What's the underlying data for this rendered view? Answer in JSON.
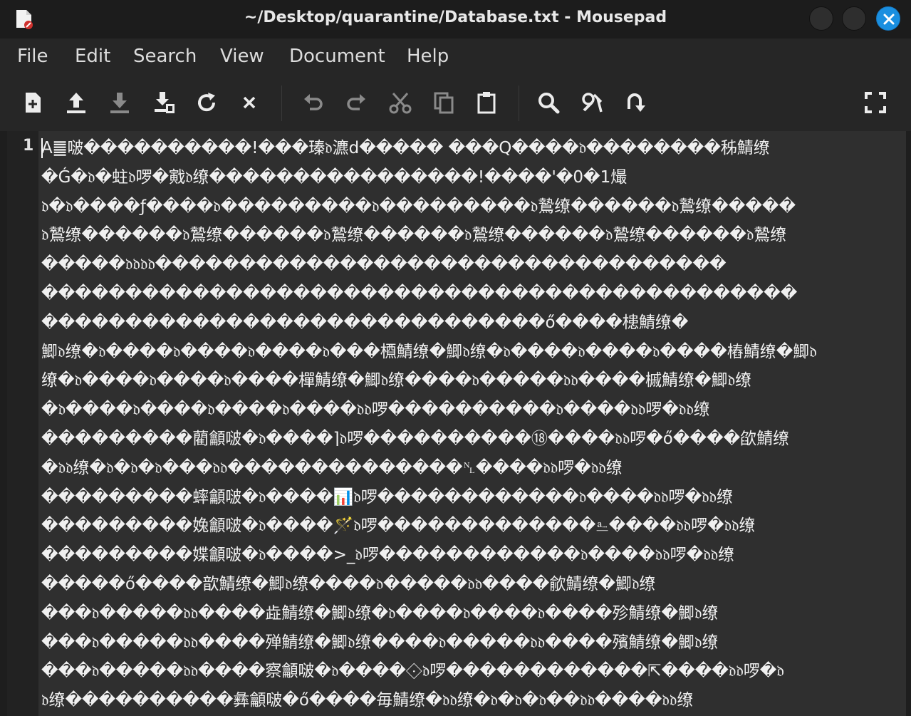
{
  "window": {
    "title": "~/Desktop/quarantine/Database.txt - Mousepad"
  },
  "menubar": {
    "items": [
      "File",
      "Edit",
      "Search",
      "View",
      "Document",
      "Help"
    ]
  },
  "toolbar": {
    "icons": [
      "new-document",
      "open",
      "save",
      "save-as",
      "reload",
      "close",
      "undo",
      "redo",
      "cut",
      "copy",
      "paste",
      "find",
      "find-replace",
      "go-to",
      "fullscreen"
    ]
  },
  "editor": {
    "line_number": "1",
    "lines": [
      "A䷀啵����������!���瑧𝔡瀌d�����  ���Q����𝔡��������秭鯖缭",
      "�Ǵ�𝔡�蛀𝔡啰�戭𝔡缭����������������!����'�0�1熶",
      "𝔡�𝔡����ƒ����𝔡���������𝔡���������𝔡鷙缭������𝔡鷙缭�����",
      "𝔡鷙缭������𝔡鷙缭������𝔡鷙缭������𝔡鷙缭������𝔡鷙缭������𝔡鷙缭",
      "�����𝔡𝔡𝔡𝔡����������������������������������",
      "���������������������������������������������",
      "������������������������������ő����槵鯖缭�",
      "鯽𝔡缭�𝔡����𝔡����𝔡����𝔡���槱鯖缭�鯽𝔡缭�𝔡����𝔡����𝔡����樁鯖缭�鯽𝔡",
      "缭�𝔡����𝔡����𝔡����樿鯖缭�鯽𝔡缭����𝔡�����𝔡𝔡����槭鯖缭�鯽𝔡缭",
      "�𝔡����𝔡����𝔡����𝔡����𝔡𝔡啰����������𝔡����𝔡𝔡啰�𝔡𝔡缭",
      "���������藺龥啵�𝔡����⌉𝔡啰����������⑱����𝔡𝔡啰�ő����欿鯖缭",
      "�𝔡𝔡缭�𝔡�𝔡�𝔡���𝔡𝔡��������������␤����𝔡𝔡啰�𝔡𝔡缭",
      "���������蟀龥啵�𝔡����📊𝔡啰������������𝔡����𝔡𝔡啰�𝔡𝔡缭",
      "���������婏龥啵�𝔡����🪄𝔡啰�������������⎁����𝔡𝔡啰�𝔡𝔡缭",
      "���������媟龥啵�𝔡����>_𝔡啰������������𝔡����𝔡𝔡啰�𝔡𝔡缭",
      "�����ő����歆鯖缭�鯽𝔡缭����𝔡�����𝔡𝔡����歈鯖缭�鯽𝔡缭",
      "���𝔡�����𝔡𝔡����歮鯖缭�鯽𝔡缭�𝔡����𝔡����𝔡����殄鯖缭�鯽𝔡缭",
      "���𝔡�����𝔡𝔡����殚鯖缭�鯽𝔡缭����𝔡�����𝔡𝔡����殯鯖缭�鯽𝔡缭",
      "���𝔡�����𝔡𝔡����察龥啵�𝔡����⟐𝔡啰������������⇱����𝔡𝔡啰�𝔡",
      "𝔡缭����������彝龥啵�ő����毎鯖缭�𝔡𝔡缭�𝔡�𝔡�𝔡��𝔡𝔡����𝔡𝔡缭"
    ]
  }
}
